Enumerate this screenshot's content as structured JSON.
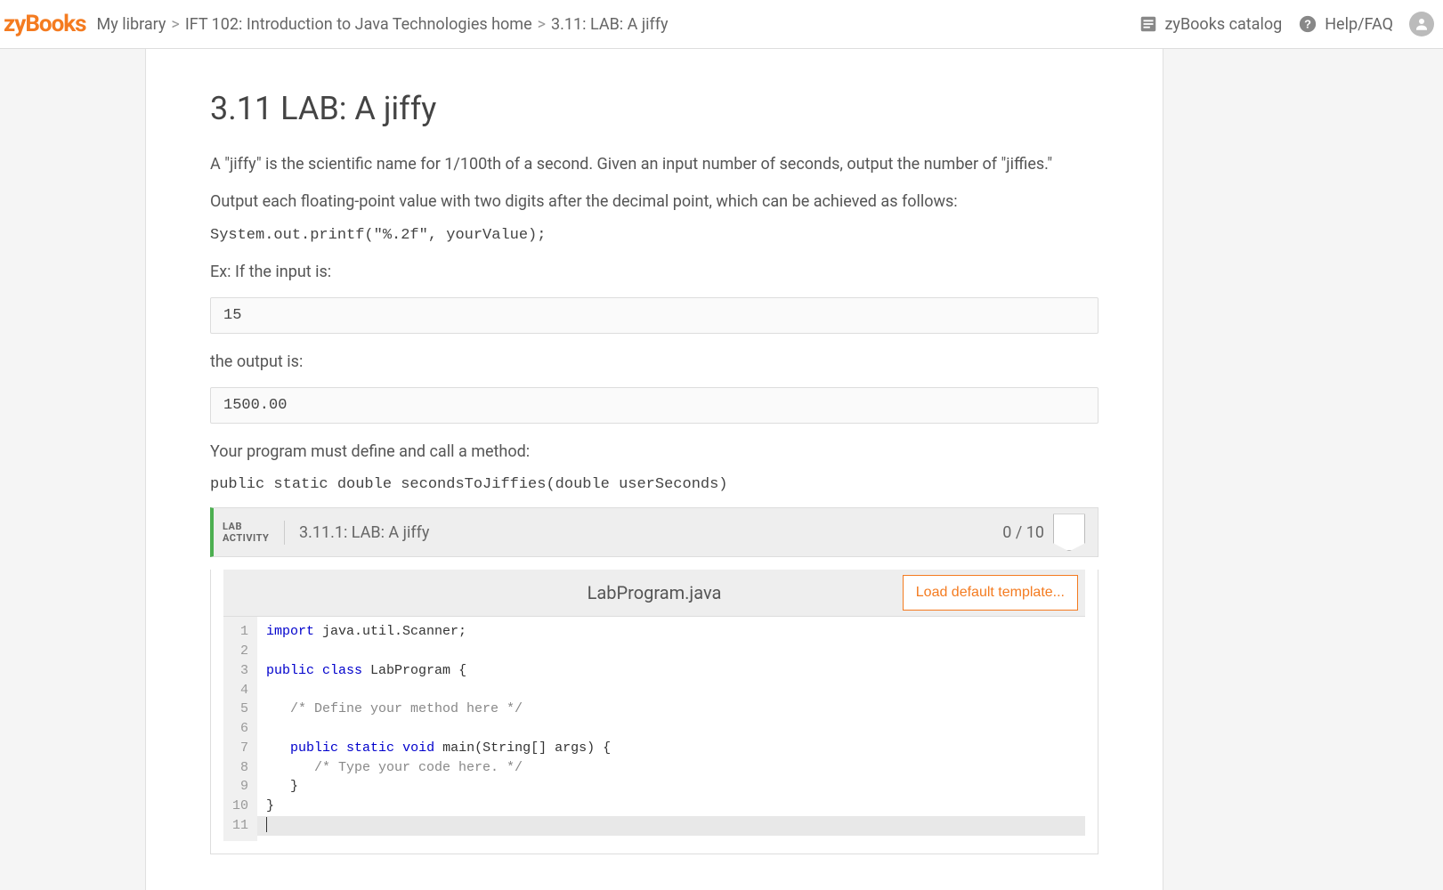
{
  "header": {
    "logo": "zyBooks",
    "breadcrumb": {
      "my_library": "My library",
      "course": "IFT 102: Introduction to Java Technologies home",
      "section": "3.11: LAB: A jiffy"
    },
    "right": {
      "catalog": "zyBooks catalog",
      "help": "Help/FAQ"
    }
  },
  "page": {
    "title": "3.11 LAB: A jiffy",
    "intro": "A \"jiffy\" is the scientific name for 1/100th of a second. Given an input number of seconds, output the number of \"jiffies.\"",
    "instr_fp": "Output each floating-point value with two digits after the decimal point, which can be achieved as follows:",
    "instr_code": "System.out.printf(\"%.2f\", yourValue);",
    "ex_label": "Ex: If the input is:",
    "ex_input": "15",
    "ex_out_label": "the output is:",
    "ex_output": "1500.00",
    "method_label": "Your program must define and call a method:",
    "method_sig": "public static double secondsToJiffies(double userSeconds)"
  },
  "lab": {
    "tag_line1": "LAB",
    "tag_line2": "ACTIVITY",
    "title": "3.11.1: LAB: A jiffy",
    "score": "0 / 10",
    "filename": "LabProgram.java",
    "load_template": "Load default template...",
    "line_numbers": [
      "1",
      "2",
      "3",
      "4",
      "5",
      "6",
      "7",
      "8",
      "9",
      "10",
      "11"
    ],
    "code": {
      "l1_a": "import",
      "l1_b": " java.util.Scanner;",
      "l3_a": "public",
      "l3_b": " ",
      "l3_c": "class",
      "l3_d": " LabProgram {",
      "l5": "   /* Define your method here */",
      "l7_a": "   ",
      "l7_b": "public",
      "l7_c": " ",
      "l7_d": "static",
      "l7_e": " ",
      "l7_f": "void",
      "l7_g": " main(String[] args) {",
      "l8": "      /* Type your code here. */",
      "l9": "   }",
      "l10": "}"
    }
  }
}
